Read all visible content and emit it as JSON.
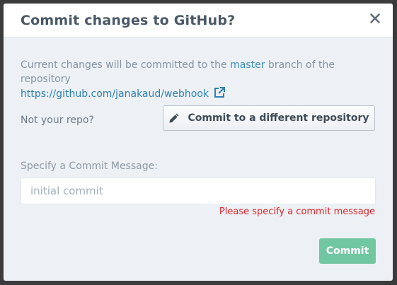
{
  "dialog": {
    "title": "Commit changes to GitHub?",
    "close_icon": "close-icon"
  },
  "description": {
    "prefix": "Current changes will be committed to the ",
    "branch": "master",
    "suffix": " branch of the repository",
    "repo_url": "https://github.com/janakaud/webhook",
    "link_icon": "external-link-icon"
  },
  "not_repo": {
    "label": "Not your repo?",
    "button_label": "Commit to a different repository",
    "button_icon": "pencil-icon"
  },
  "commit_message": {
    "label": "Specify a Commit Message:",
    "value": "",
    "placeholder": "initial commit",
    "error": "Please specify a commit message"
  },
  "actions": {
    "commit_label": "Commit",
    "commit_enabled": false
  },
  "colors": {
    "link": "#2c80b4",
    "error": "#e2232a",
    "commit_button": "#72c7a3",
    "dialog_background": "#edf1f5"
  }
}
